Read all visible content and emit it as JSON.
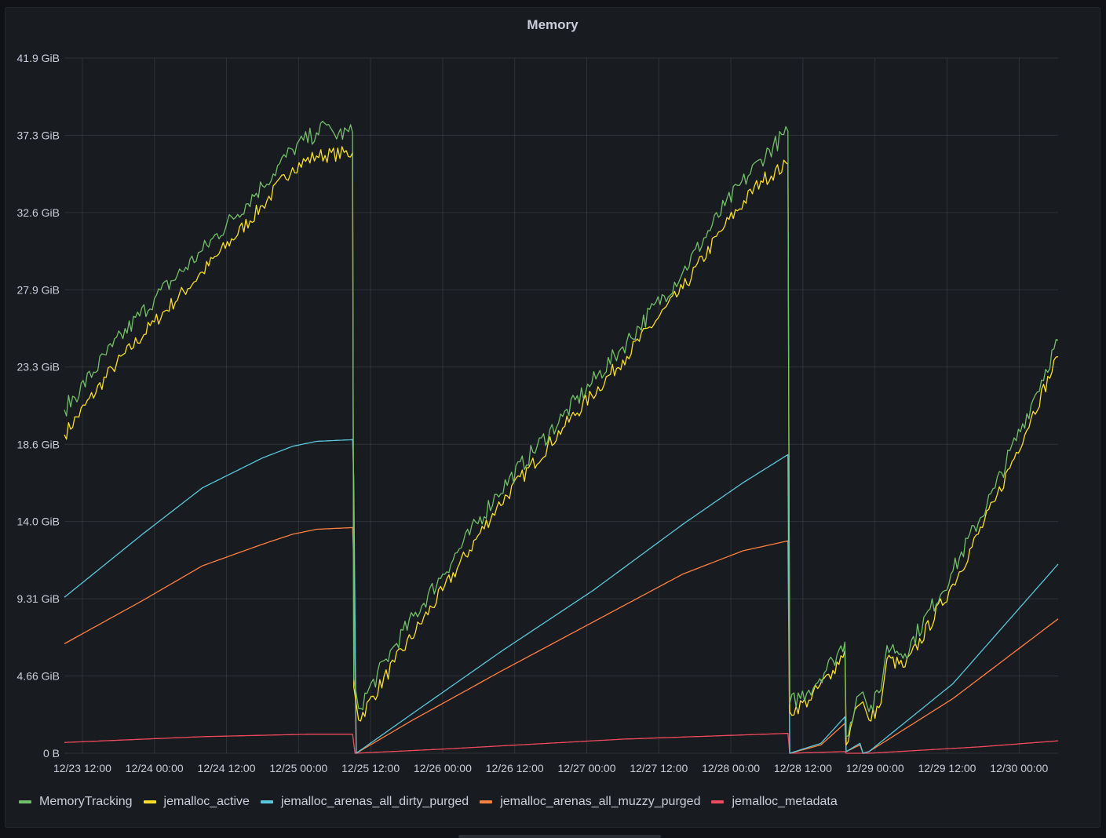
{
  "panel": {
    "title": "Memory"
  },
  "chart_data": {
    "type": "line",
    "title": "Memory",
    "x_axis": {
      "tick_labels": [
        "12/23 12:00",
        "12/24 00:00",
        "12/24 12:00",
        "12/25 00:00",
        "12/25 12:00",
        "12/26 00:00",
        "12/26 12:00",
        "12/27 00:00",
        "12/27 12:00",
        "12/28 00:00",
        "12/28 12:00",
        "12/29 00:00",
        "12/29 12:00",
        "12/30 00:00"
      ],
      "range_hours": [
        -3,
        162.5
      ]
    },
    "y_axis": {
      "unit": "GiB",
      "tick_labels": [
        "0 B",
        "4.66 GiB",
        "9.31 GiB",
        "14.0 GiB",
        "18.6 GiB",
        "23.3 GiB",
        "27.9 GiB",
        "32.6 GiB",
        "37.3 GiB",
        "41.9 GiB"
      ],
      "tick_values": [
        0,
        4.66,
        9.31,
        13.97,
        18.62,
        23.28,
        27.93,
        32.59,
        37.25,
        41.9
      ],
      "ylim": [
        0,
        41.9
      ]
    },
    "grid": true,
    "legend_position": "bottom-left",
    "series": [
      {
        "name": "MemoryTracking",
        "color": "#73bf69",
        "noise": 0.55,
        "points": [
          [
            -3,
            20.7
          ],
          [
            5,
            24.5
          ],
          [
            12,
            27.4
          ],
          [
            20,
            30.3
          ],
          [
            30,
            34.2
          ],
          [
            35,
            36.4
          ],
          [
            39,
            37.4
          ],
          [
            41,
            37.9
          ],
          [
            42,
            37.3
          ],
          [
            45,
            37.4
          ],
          [
            45.2,
            4.5
          ],
          [
            46,
            2.7
          ],
          [
            52,
            6.5
          ],
          [
            60,
            10.8
          ],
          [
            69,
            15.6
          ],
          [
            80,
            20.3
          ],
          [
            90,
            24.5
          ],
          [
            100,
            29.0
          ],
          [
            107,
            33.0
          ],
          [
            113,
            35.8
          ],
          [
            117.5,
            37.5
          ],
          [
            117.8,
            3.0
          ],
          [
            121,
            3.8
          ],
          [
            125,
            5.6
          ],
          [
            127,
            6.7
          ],
          [
            127.2,
            1.0
          ],
          [
            129,
            3.4
          ],
          [
            130,
            3.7
          ],
          [
            131,
            2.5
          ],
          [
            133,
            3.8
          ],
          [
            134,
            6.5
          ],
          [
            137,
            6.0
          ],
          [
            145,
            11.0
          ],
          [
            152,
            16.0
          ],
          [
            158,
            21.0
          ],
          [
            162.5,
            24.9
          ]
        ]
      },
      {
        "name": "jemalloc_active",
        "color": "#fade2a",
        "noise": 0.45,
        "points": [
          [
            -3,
            19.2
          ],
          [
            5,
            23.2
          ],
          [
            12,
            26.0
          ],
          [
            20,
            29.0
          ],
          [
            30,
            33.0
          ],
          [
            35,
            35.3
          ],
          [
            39,
            36.0
          ],
          [
            45,
            36.2
          ],
          [
            45.2,
            4.0
          ],
          [
            46,
            2.0
          ],
          [
            52,
            5.5
          ],
          [
            60,
            9.8
          ],
          [
            69,
            14.8
          ],
          [
            80,
            19.6
          ],
          [
            90,
            23.7
          ],
          [
            100,
            28.0
          ],
          [
            107,
            31.8
          ],
          [
            113,
            34.5
          ],
          [
            117.5,
            35.5
          ],
          [
            117.8,
            2.5
          ],
          [
            121,
            3.2
          ],
          [
            125,
            5.0
          ],
          [
            127,
            6.2
          ],
          [
            127.2,
            0.5
          ],
          [
            129,
            2.8
          ],
          [
            130,
            3.1
          ],
          [
            131,
            2.0
          ],
          [
            133,
            3.0
          ],
          [
            134,
            5.7
          ],
          [
            137,
            5.2
          ],
          [
            145,
            10.2
          ],
          [
            152,
            15.2
          ],
          [
            158,
            20.2
          ],
          [
            162.5,
            23.9
          ]
        ]
      },
      {
        "name": "jemalloc_arenas_all_dirty_purged",
        "color": "#5ac8de",
        "noise": 0.0,
        "points": [
          [
            -3,
            9.4
          ],
          [
            10,
            13.2
          ],
          [
            20,
            16.0
          ],
          [
            30,
            17.8
          ],
          [
            35,
            18.5
          ],
          [
            39,
            18.8
          ],
          [
            45,
            18.9
          ],
          [
            45.2,
            16.5
          ],
          [
            45.6,
            0.0
          ],
          [
            55,
            2.4
          ],
          [
            70,
            6.2
          ],
          [
            85,
            9.8
          ],
          [
            100,
            13.8
          ],
          [
            110,
            16.3
          ],
          [
            117.5,
            18.0
          ],
          [
            117.8,
            0.0
          ],
          [
            123,
            0.6
          ],
          [
            127,
            2.2
          ],
          [
            127.2,
            0.1
          ],
          [
            129.5,
            0.6
          ],
          [
            130,
            0.0
          ],
          [
            131,
            0.1
          ],
          [
            145,
            4.2
          ],
          [
            162.5,
            11.4
          ]
        ]
      },
      {
        "name": "jemalloc_arenas_all_muzzy_purged",
        "color": "#ff7f3f",
        "noise": 0.0,
        "points": [
          [
            -3,
            6.6
          ],
          [
            10,
            9.2
          ],
          [
            20,
            11.3
          ],
          [
            30,
            12.6
          ],
          [
            35,
            13.2
          ],
          [
            39,
            13.5
          ],
          [
            45,
            13.6
          ],
          [
            45.2,
            11.5
          ],
          [
            45.6,
            0.0
          ],
          [
            55,
            2.0
          ],
          [
            70,
            5.0
          ],
          [
            85,
            7.9
          ],
          [
            100,
            10.8
          ],
          [
            110,
            12.2
          ],
          [
            117.5,
            12.8
          ],
          [
            117.8,
            0.0
          ],
          [
            123,
            0.5
          ],
          [
            127,
            1.8
          ],
          [
            127.2,
            0.1
          ],
          [
            129.5,
            0.5
          ],
          [
            130,
            0.0
          ],
          [
            131,
            0.1
          ],
          [
            145,
            3.3
          ],
          [
            162.5,
            8.1
          ]
        ]
      },
      {
        "name": "jemalloc_metadata",
        "color": "#f2495c",
        "noise": 0.0,
        "points": [
          [
            -3,
            0.65
          ],
          [
            20,
            1.0
          ],
          [
            38,
            1.15
          ],
          [
            45,
            1.15
          ],
          [
            45.4,
            0.0
          ],
          [
            60,
            0.25
          ],
          [
            90,
            0.85
          ],
          [
            117.5,
            1.2
          ],
          [
            117.8,
            0.0
          ],
          [
            127,
            0.1
          ],
          [
            127.2,
            0.0
          ],
          [
            131,
            0.0
          ],
          [
            150,
            0.4
          ],
          [
            162.5,
            0.75
          ]
        ]
      }
    ]
  }
}
